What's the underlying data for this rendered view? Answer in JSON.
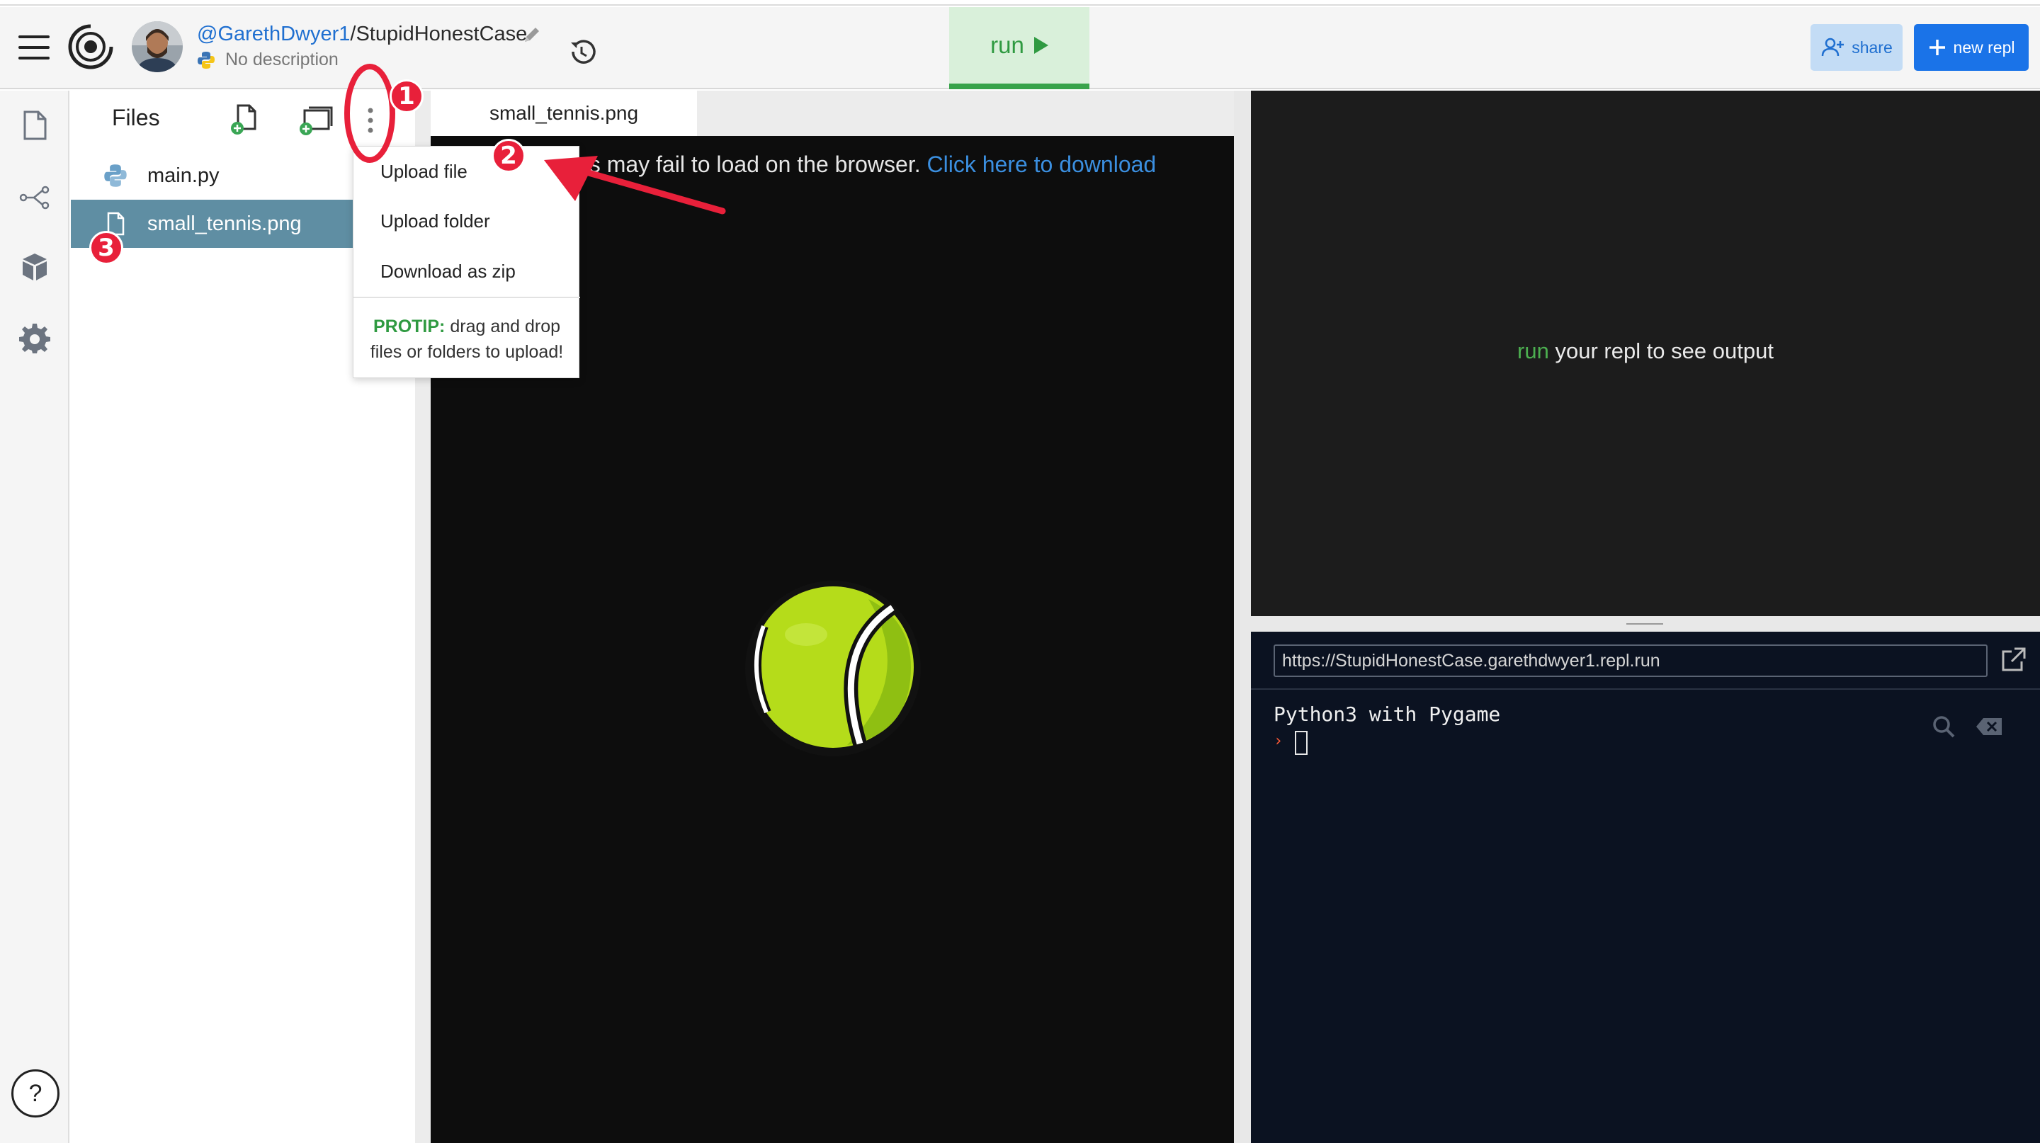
{
  "header": {
    "user": "@GarethDwyer1",
    "separator": "/",
    "repl_name": "StupidHonestCase",
    "description": "No description",
    "run_label": "run",
    "share_label": "share",
    "new_repl_label": "new repl"
  },
  "rail": {
    "icons": [
      "files-icon",
      "version-control-icon",
      "packages-icon",
      "settings-icon"
    ],
    "help_label": "?"
  },
  "files": {
    "title": "Files",
    "items": [
      {
        "name": "main.py",
        "icon": "python-file-icon",
        "selected": false
      },
      {
        "name": "small_tennis.png",
        "icon": "file-icon",
        "selected": true
      }
    ]
  },
  "menu": {
    "items": [
      "Upload file",
      "Upload folder",
      "Download as zip"
    ],
    "protip_label": "PROTIP:",
    "protip_line1": " drag and drop",
    "protip_line2": "files or folders to upload!"
  },
  "editor": {
    "tab_label": "small_tennis.png",
    "warning_visible": "es may fail to load on the browser.",
    "warning_link": "Click here to download"
  },
  "output": {
    "run_word": "run",
    "message_rest": " your repl to see output"
  },
  "console": {
    "url": "https://StupidHonestCase.garethdwyer1.repl.run",
    "title": "Python3 with Pygame",
    "prompt_symbol": "›"
  },
  "annotations": {
    "badge1": "1",
    "badge2": "2",
    "badge3": "3",
    "color": "#e8203a"
  },
  "colors": {
    "link_blue": "#1f6fd0",
    "run_green": "#2f9a41",
    "selected_row": "#5f8ea3",
    "console_bg": "#0b1221",
    "output_bg": "#1c1c1c",
    "tennis_ball": "#b5dc1a"
  }
}
